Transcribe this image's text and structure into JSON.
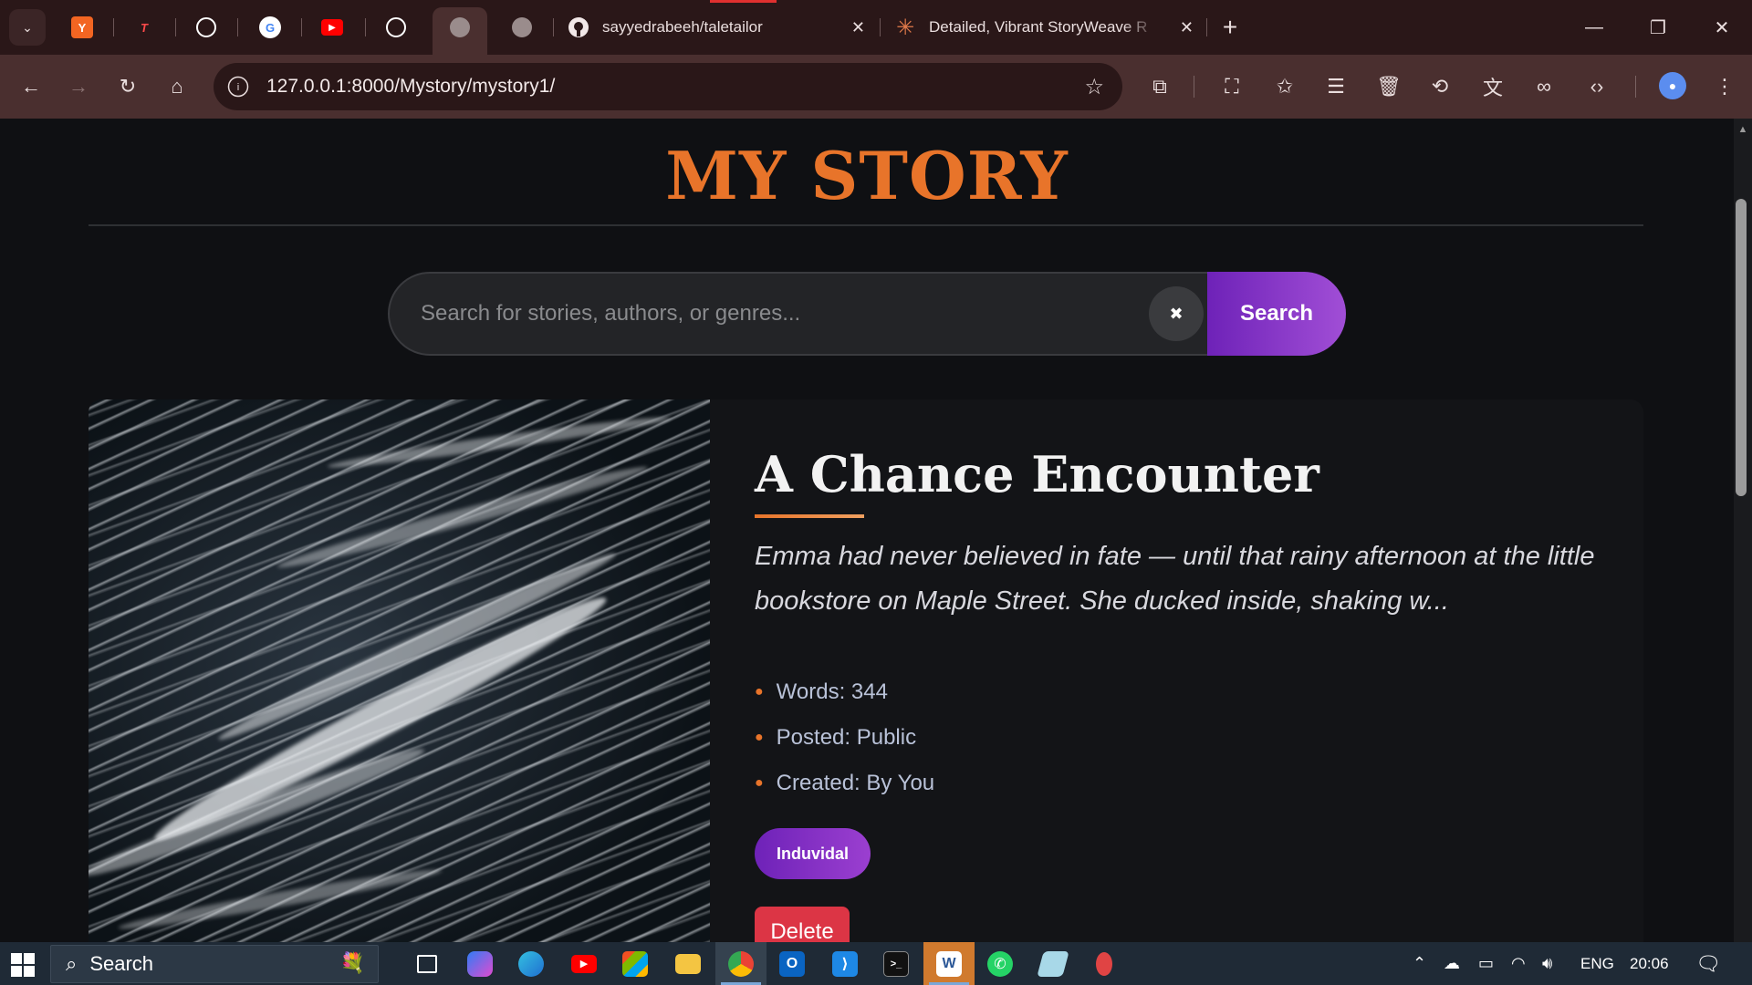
{
  "browser": {
    "pinned_tabs": [
      {
        "icon": "y-combinator-icon",
        "glyph": "Y",
        "color": "#f26522"
      },
      {
        "icon": "t-logo-icon",
        "glyph": "T",
        "color": "#c22a2a"
      },
      {
        "icon": "openai-icon",
        "glyph": "❀",
        "color": "#2a1718"
      },
      {
        "icon": "google-icon",
        "glyph": "G",
        "color": "#ffffff"
      },
      {
        "icon": "youtube-icon",
        "glyph": "▶",
        "color": "#ff0000"
      },
      {
        "icon": "openai-icon",
        "glyph": "❀",
        "color": "#2a1718"
      },
      {
        "icon": "globe-icon",
        "glyph": "◍",
        "color": "#4a2f2f"
      },
      {
        "icon": "globe-icon",
        "glyph": "◍",
        "color": "#2a1718"
      }
    ],
    "tabs": [
      {
        "title": "sayyedrabeeh/taletailor",
        "icon": "github-icon"
      },
      {
        "title": "Detailed, Vibrant StoryWeave R",
        "icon": "claude-icon"
      }
    ],
    "url": "127.0.0.1:8000/Mystory/mystory1/"
  },
  "page": {
    "site_title": "MY STORY",
    "search": {
      "placeholder": "Search for stories, authors, or genres...",
      "value": "",
      "clear_label": "✖",
      "button_label": "Search"
    },
    "story": {
      "title": "A Chance Encounter",
      "excerpt": "Emma had never believed in fate — until that rainy afternoon at the little bookstore on Maple Street. She ducked inside, shaking w...",
      "meta": [
        {
          "text": "Words: 344"
        },
        {
          "text": "Posted: Public"
        },
        {
          "text": "Created: By You"
        }
      ],
      "tag": "Induvidal",
      "delete_label": "Delete"
    }
  },
  "taskbar": {
    "search_label": "Search",
    "language": "ENG",
    "time": "20:06"
  },
  "colors": {
    "accent_orange": "#e8742a",
    "accent_purple": "#6e22b8",
    "danger": "#dc3545",
    "background": "#0f1013"
  }
}
